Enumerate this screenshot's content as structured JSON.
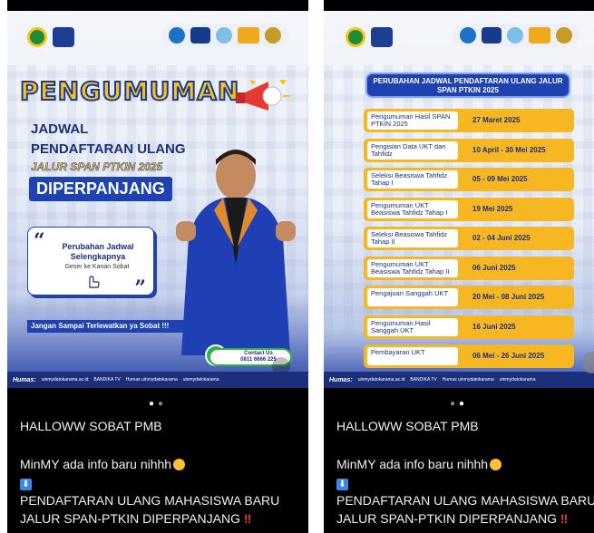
{
  "left_post": {
    "headline": "PENGUMUMAN",
    "subtitle_line1": "JADWAL",
    "subtitle_line2": "PENDAFTARAN ULANG",
    "subtitle_line3": "JALUR SPAN PTKIN 2025",
    "status_badge": "DIPERPANJANG",
    "quote_card": {
      "title": "Perubahan Jadwal Selengkapnya",
      "subtitle": "Geser ke Kanan Sobat"
    },
    "banner_text": "Jangan Sampai Terlewatkan ya Sobat !!!",
    "contact": {
      "label": "Contact Us",
      "phone": "0811 6666 225"
    },
    "footer": {
      "humas": "Humas:",
      "items": [
        "uinmydatokarama.ac.id",
        "BANDIKA TV",
        "Humas uinmydatokarama",
        "uinmydatokarama"
      ]
    }
  },
  "right_post": {
    "title": "PERUBAHAN JADWAL PENDAFTARAN ULANG JALUR SPAN PTKIN 2025",
    "schedule": [
      {
        "label": "Pengumuman Hasil SPAN PTKIN 2025",
        "date": "27 Maret 2025"
      },
      {
        "label": "Pengisian Data UKT dan Tahfidz",
        "date": "10 April - 30 Mei 2025"
      },
      {
        "label": "Seleksi Beasiswa Tahfidz Tahap I",
        "date": "05 - 09 Mei 2025"
      },
      {
        "label": "Pengumuman UKT Beasiswa Tahfidz Tahap I",
        "date": "19 Mei 2025"
      },
      {
        "label": "Seleksi Beasiswa Tahfidz Tahap II",
        "date": "02 - 04 Juni 2025"
      },
      {
        "label": "Pengumuman UKT Beasiswa Tahfidz Tahap II",
        "date": "06 Juni 2025"
      },
      {
        "label": "Pengajuan Sanggah UKT",
        "date": "20 Mei - 08 Juni 2025"
      },
      {
        "label": "Pengumuman Hasil Sanggah UKT",
        "date": "16 Juni 2025"
      },
      {
        "label": "Pembayaran UKT",
        "date": "06 Mei - 26 Juni 2025"
      }
    ],
    "footer": {
      "humas": "Humas:",
      "items": [
        "uinmydatokarama.ac.id",
        "BANDIKA TV",
        "Humas uinmydatokarama",
        "uinmydatokarama"
      ]
    }
  },
  "captions": {
    "greeting": "HALLOWW SOBAT PMB",
    "line1": "MinMY ada info baru nihhh",
    "line2": "PENDAFTARAN ULANG MAHASISWA BARU",
    "line3": "JALUR SPAN-PTKIN DIPERPANJANG"
  },
  "colors": {
    "accent_blue": "#1e42b0",
    "accent_yellow": "#f7b722",
    "whatsapp_green": "#2fb24a"
  }
}
